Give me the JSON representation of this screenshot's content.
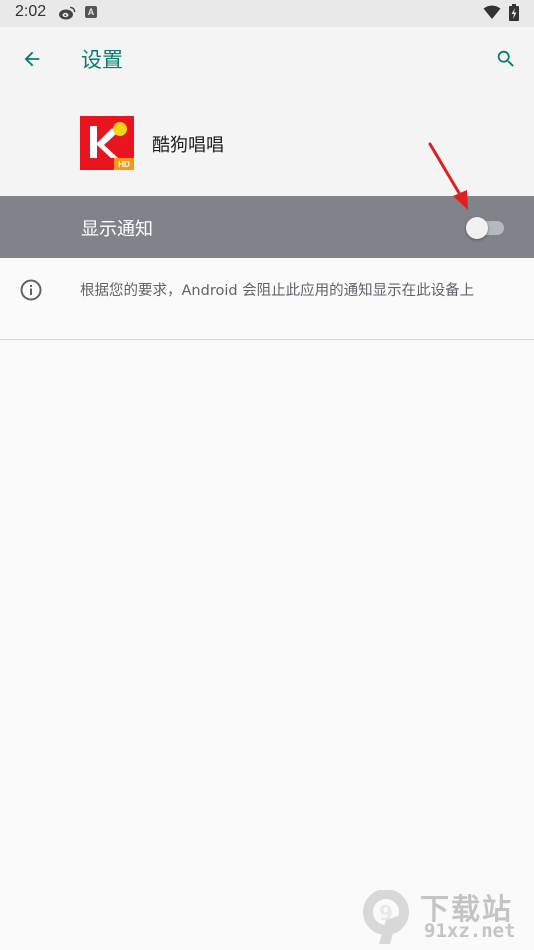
{
  "status_bar": {
    "time": "2:02",
    "notification_letter": "A",
    "icons": [
      "weibo-icon",
      "notification-a-icon",
      "wifi-icon",
      "battery-charging-icon"
    ]
  },
  "app_bar": {
    "title": "设置",
    "back_icon": "arrow-back-icon",
    "search_icon": "search-icon",
    "accent_color": "#0a7c6e"
  },
  "app_header": {
    "app_name": "酷狗唱唱",
    "app_icon": "kugou-changchang-logo",
    "app_icon_badge": "HD",
    "app_icon_letter": "K"
  },
  "notification_toggle": {
    "label": "显示通知",
    "enabled": false,
    "row_color": "#80848a"
  },
  "info": {
    "icon": "info-icon",
    "text": "根据您的要求，Android 会阻止此应用的通知显示在此设备上"
  },
  "annotation": {
    "arrow_color": "#e02020"
  },
  "watermark": {
    "logo_text": "9",
    "title": "下载站",
    "url": "91xz.net"
  }
}
